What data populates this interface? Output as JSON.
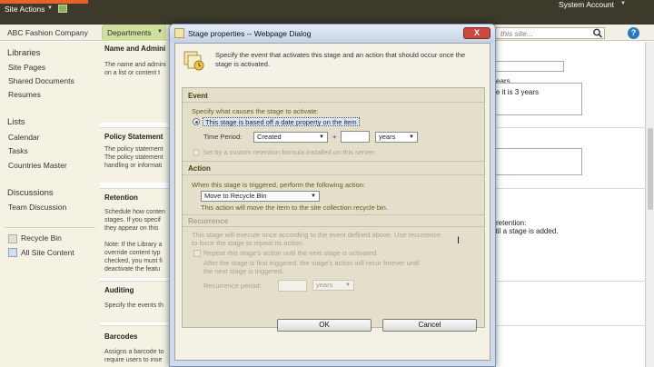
{
  "topbar": {
    "site_actions": "Site Actions",
    "system_account": "System Account"
  },
  "nav": {
    "company": "ABC Fashion Company",
    "departments": "Departments",
    "search_placeholder": "this site..."
  },
  "leftnav": {
    "libraries": "Libraries",
    "lib_items": [
      "Site Pages",
      "Shared Documents",
      "Resumes"
    ],
    "lists": "Lists",
    "list_items": [
      "Calendar",
      "Tasks",
      "Countries Master"
    ],
    "discussions": "Discussions",
    "disc_items": [
      "Team Discussion"
    ],
    "recycle_bin": "Recycle Bin",
    "all_site_content": "All Site Content"
  },
  "main": {
    "name_admin": {
      "title": "Name and Admini",
      "text": [
        "The name and admini",
        "on a list or content t"
      ]
    },
    "policy": {
      "title": "Policy Statement",
      "text": [
        "The policy statement",
        "The policy statement",
        "handling or informati"
      ]
    },
    "retention": {
      "title": "Retention",
      "text": [
        "Schedule how conten",
        "stages. If you specif",
        "they appear on this",
        "",
        "Note: If the Library a",
        "override content typ",
        "checked, you must fi",
        "deactivate the featu"
      ]
    },
    "auditing": {
      "title": "Auditing",
      "text": [
        "Specify the events th"
      ]
    },
    "barcodes": {
      "title": "Barcodes",
      "text": [
        "Assigns a barcode to",
        "require users to inse"
      ]
    },
    "right_text": {
      "years_partial": "ears",
      "once_text": "once it is 3 years",
      "retention_label": "retention:",
      "stage_added": "e until a stage is added."
    }
  },
  "dialog": {
    "title": "Stage properties -- Webpage Dialog",
    "close": "X",
    "intro": "Specify the event that activates this stage and an action that should occur once the stage is activated.",
    "event": {
      "heading": "Event",
      "prompt": "Specify what causes the stage to activate:",
      "option_date": "This stage is based off a date property on the item",
      "time_period_label": "Time Period:",
      "time_period_value": "Created",
      "plus": "+",
      "years_value": "years",
      "option_formula": "Set by a custom retention formula installed on this server:"
    },
    "action": {
      "heading": "Action",
      "prompt": "When this stage is triggered, perform the following action:",
      "value": "Move to Recycle Bin",
      "description": "This action will move the item to the site collection recycle bin."
    },
    "recurrence": {
      "heading": "Recurrence",
      "line1": "This stage will execute once according to the event defined above. Use recurrence",
      "line2": "to force the stage to repeat its action.",
      "repeat_label": "Repeat this stage's action until the next stage is activated",
      "after1": "After the stage is first triggered, the stage's action will recur forever until",
      "after2": "the next stage is triggered.",
      "period_label": "Recurrence period:",
      "period_unit": "years"
    },
    "ok": "OK",
    "cancel": "Cancel"
  },
  "colors": {
    "topbar": "#3d3a2c",
    "departments_tab": "#cfe09e",
    "dialog_panel": "#e3dfcb",
    "section_heading": "#4b3d10"
  }
}
